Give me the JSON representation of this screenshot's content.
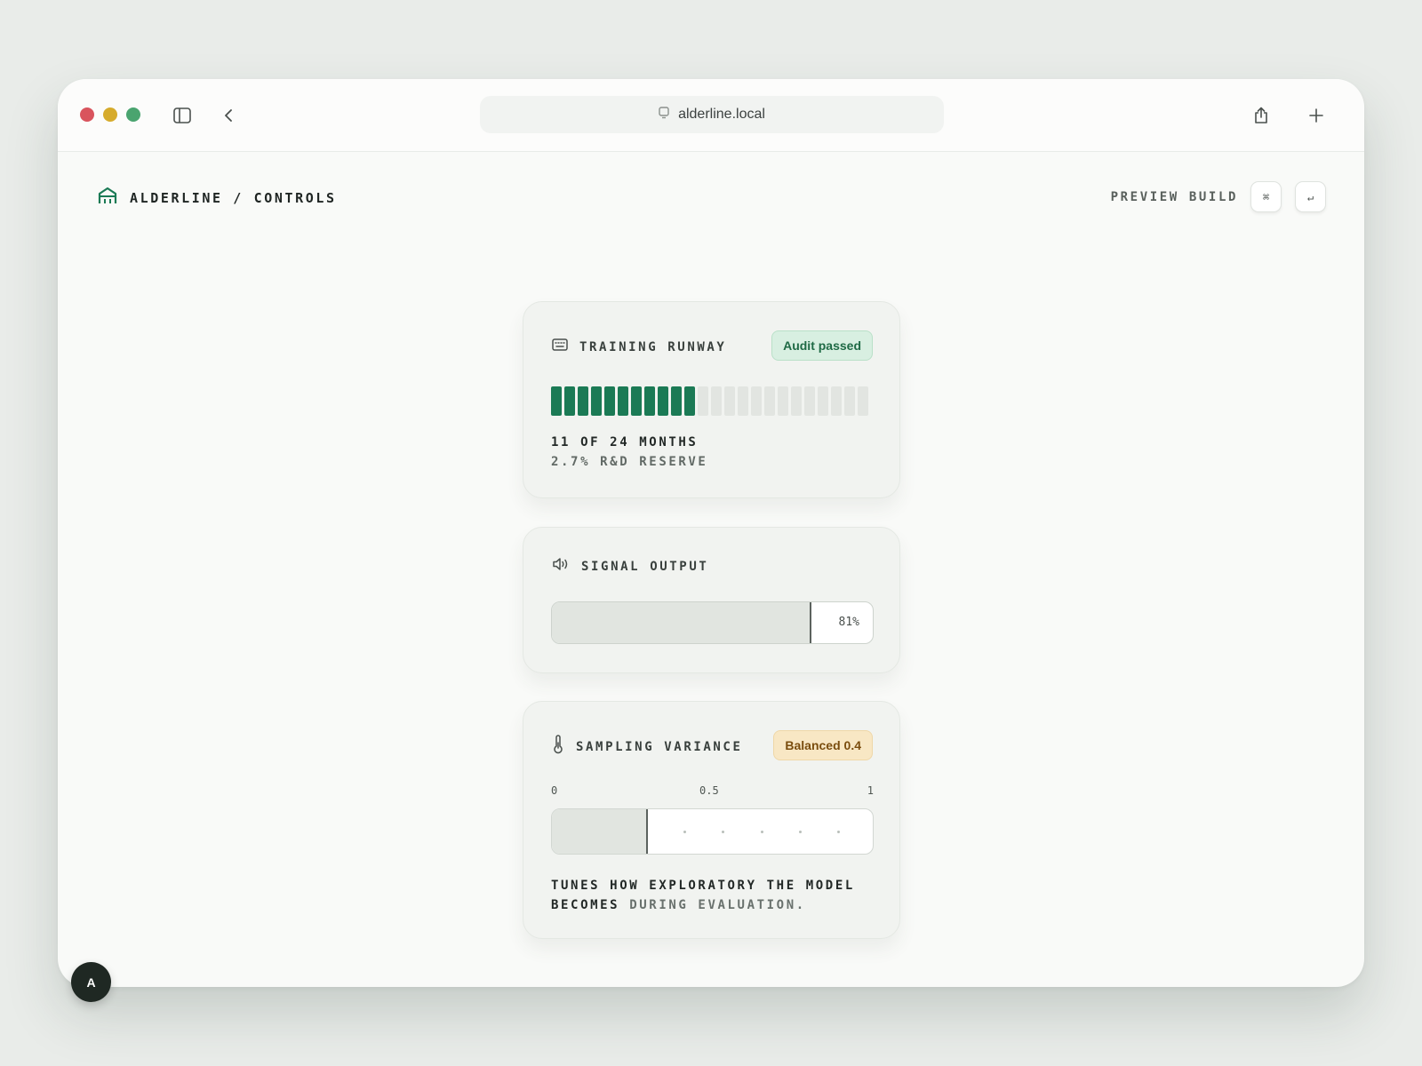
{
  "browser": {
    "url": "alderline.local"
  },
  "header": {
    "breadcrumb": "ALDERLINE / CONTROLS",
    "preview_label": "PREVIEW BUILD",
    "kbd_command": "⌘",
    "kbd_enter": "↵"
  },
  "cards": {
    "runway": {
      "title": "TRAINING RUNWAY",
      "badge": "Audit passed",
      "months_done": 11,
      "months_total": 24,
      "stat_primary": "11 OF 24 MONTHS",
      "stat_secondary": "2.7% R&D RESERVE"
    },
    "signal": {
      "title": "SIGNAL OUTPUT",
      "value": 81,
      "value_label": "81%"
    },
    "variance": {
      "title": "SAMPLING VARIANCE",
      "badge": "Balanced 0.4",
      "value": 0.3,
      "tick_min": "0",
      "tick_mid": "0.5",
      "tick_max": "1",
      "desc_main": "TUNES HOW EXPLORATORY THE MODEL BECOMES",
      "desc_muted": " DURING EVALUATION."
    }
  },
  "avatar": {
    "initial": "A"
  },
  "colors": {
    "accent": "#1b7a55",
    "badge_green_bg": "#d8efe1",
    "badge_amber_bg": "#f8e7c4",
    "traffic_red": "#d9545d",
    "traffic_yellow": "#d6ab2c",
    "traffic_green": "#4aa46f"
  }
}
